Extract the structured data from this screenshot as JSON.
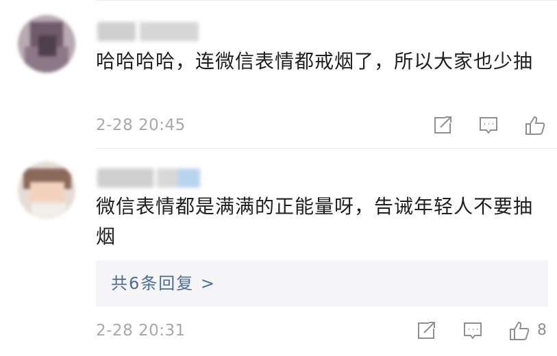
{
  "comments": [
    {
      "text": "哈哈哈哈，连微信表情都戒烟了，所以大家也少抽",
      "time": "2-28 20:45",
      "like_count": ""
    },
    {
      "text": "微信表情都是满满的正能量呀，告诫年轻人不要抽烟",
      "time": "2-28 20:31",
      "reply_link": "共6条回复 >",
      "like_count": "8"
    }
  ],
  "icons": {
    "share": "share-icon",
    "comment": "comment-icon",
    "like": "thumbs-up-icon"
  },
  "colors": {
    "text": "#1e1e1e",
    "meta": "#a8a8a8",
    "link": "#4a6c97",
    "reply_bg": "#f5f5f7"
  }
}
